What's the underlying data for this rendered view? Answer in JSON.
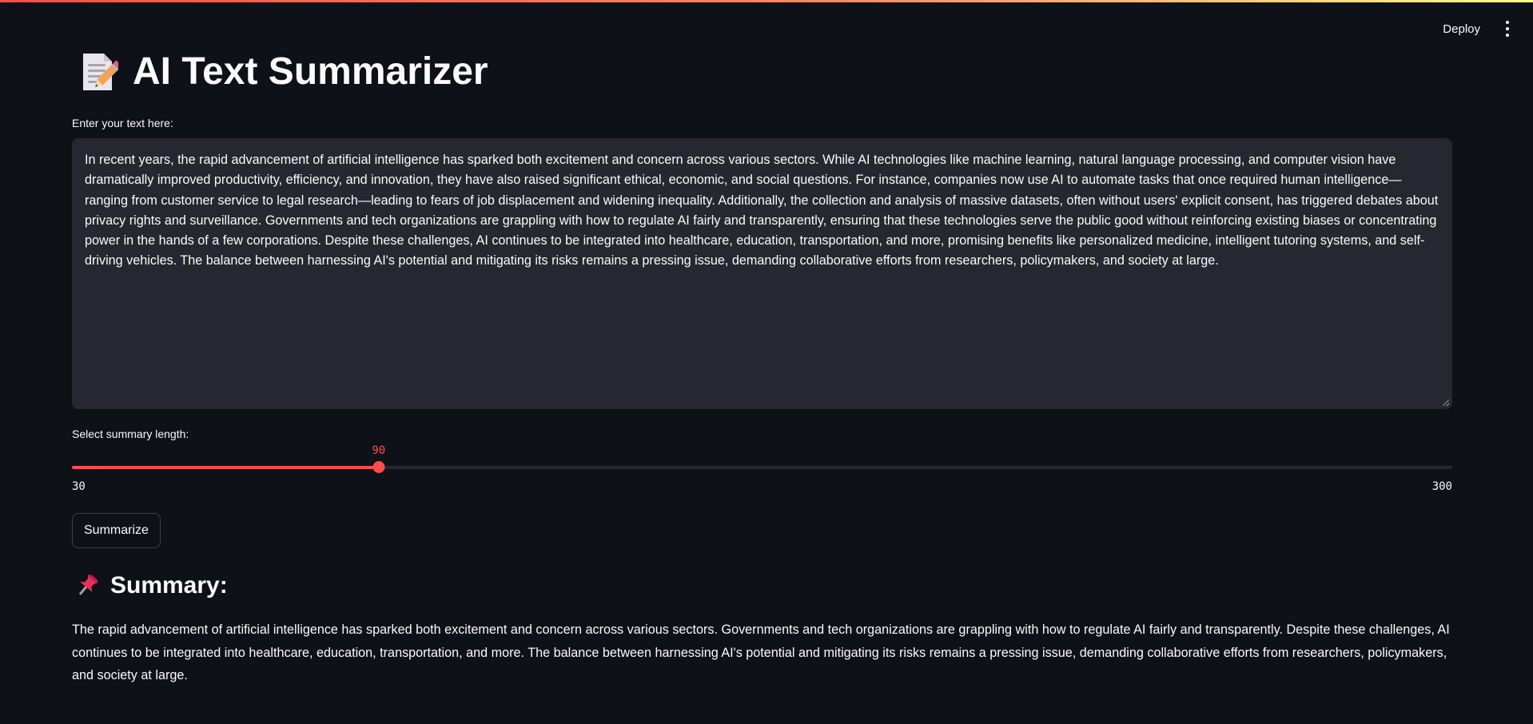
{
  "header": {
    "deploy_label": "Deploy",
    "menu_icon": "vertical-ellipsis-icon"
  },
  "title": {
    "emoji_icon": "memo-pencil-icon",
    "text": "AI Text Summarizer"
  },
  "input": {
    "label": "Enter your text here:",
    "value": "In recent years, the rapid advancement of artificial intelligence has sparked both excitement and concern across various sectors. While AI technologies like machine learning, natural language processing, and computer vision have dramatically improved productivity, efficiency, and innovation, they have also raised significant ethical, economic, and social questions. For instance, companies now use AI to automate tasks that once required human intelligence—ranging from customer service to legal research—leading to fears of job displacement and widening inequality. Additionally, the collection and analysis of massive datasets, often without users' explicit consent, has triggered debates about privacy rights and surveillance. Governments and tech organizations are grappling with how to regulate AI fairly and transparently, ensuring that these technologies serve the public good without reinforcing existing biases or concentrating power in the hands of a few corporations. Despite these challenges, AI continues to be integrated into healthcare, education, transportation, and more, promising benefits like personalized medicine, intelligent tutoring systems, and self-driving vehicles. The balance between harnessing AI's potential and mitigating its risks remains a pressing issue, demanding collaborative efforts from researchers, policymakers, and society at large."
  },
  "slider": {
    "label": "Select summary length:",
    "value": "90",
    "min": "30",
    "max": "300",
    "accent": "#ff4b4b"
  },
  "button": {
    "label": "Summarize"
  },
  "summary": {
    "emoji_icon": "pushpin-icon",
    "heading": "Summary:",
    "text": "The rapid advancement of artificial intelligence has sparked both excitement and concern across various sectors. Governments and tech organizations are grappling with how to regulate AI fairly and transparently. Despite these challenges, AI continues to be integrated into healthcare, education, transportation, and more. The balance between harnessing AI's potential and mitigating its risks remains a pressing issue, demanding collaborative efforts from researchers, policymakers, and society at large."
  },
  "colors": {
    "background": "#0e1117",
    "input_background": "#262730",
    "text": "#fafafa",
    "accent": "#ff4b4b"
  }
}
